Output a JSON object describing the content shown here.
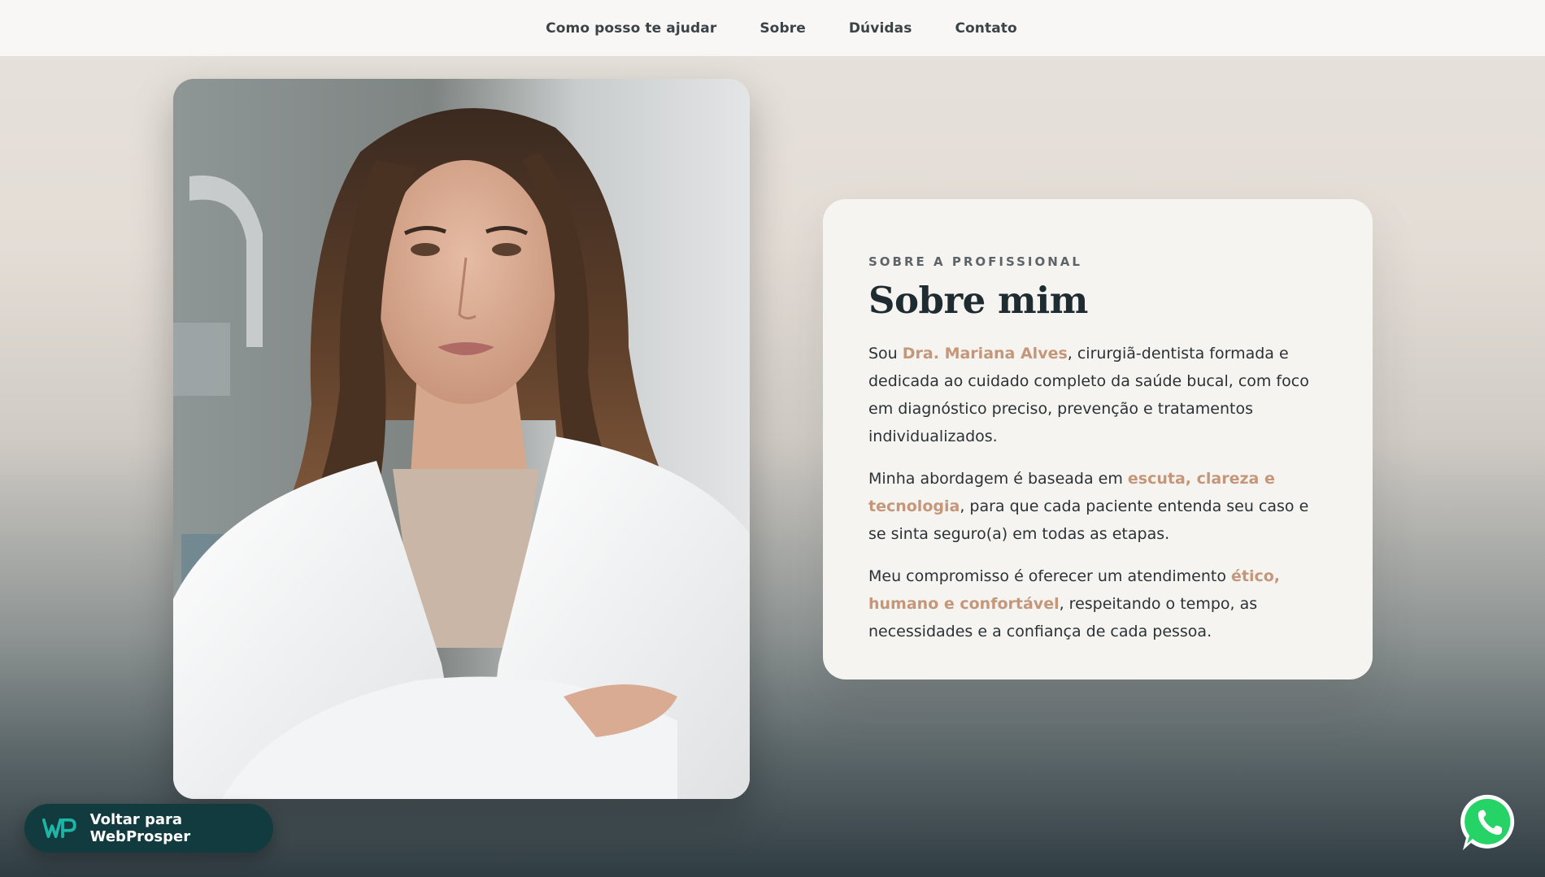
{
  "nav": {
    "items": [
      {
        "label": "Como posso te ajudar"
      },
      {
        "label": "Sobre"
      },
      {
        "label": "Dúvidas"
      },
      {
        "label": "Contato"
      }
    ]
  },
  "about": {
    "eyebrow": "SOBRE A PROFISSIONAL",
    "title": "Sobre mim",
    "p1": {
      "before": "Sou ",
      "highlight": "Dra. Mariana Alves",
      "after": ", cirurgiã-dentista formada e dedicada ao cuidado completo da saúde bucal, com foco em diagnóstico preciso, prevenção e tratamentos individualizados."
    },
    "p2": {
      "before": "Minha abordagem é baseada em ",
      "highlight": "escuta, clareza e tecnologia",
      "after": ", para que cada paciente entenda seu caso e se sinta seguro(a) em todas as etapas."
    },
    "p3": {
      "before": "Meu compromisso é oferecer um atendimento ",
      "highlight": "ético, humano e confortável",
      "after": ", respeitando o tempo, as necessidades e a confiança de cada pessoa."
    }
  },
  "back_button": {
    "logo_text": "WP",
    "label": "Voltar para WebProsper"
  },
  "colors": {
    "accent": "#c4977a",
    "dark": "#1e2b31",
    "button_bg": "#123b40",
    "logo": "#1fb5a6",
    "whatsapp": "#25d366"
  },
  "icons": {
    "whatsapp": "whatsapp-icon",
    "logo": "webprosper-logo"
  }
}
